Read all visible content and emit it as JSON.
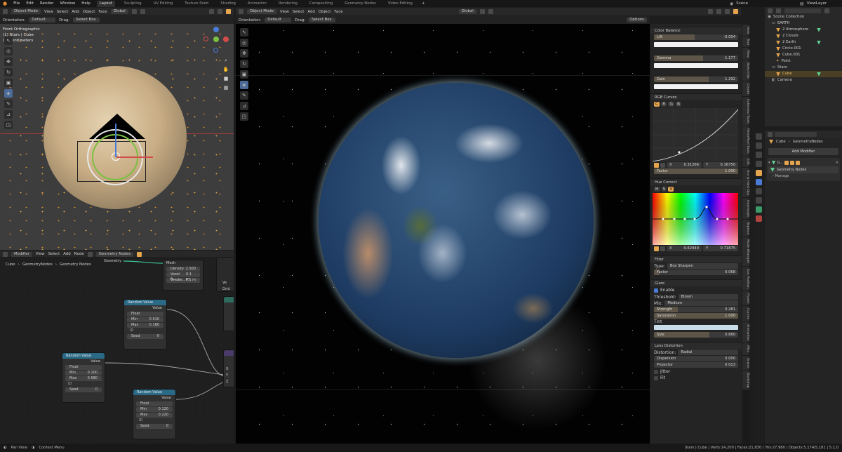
{
  "topbar": {
    "menus": [
      "File",
      "Edit",
      "Render",
      "Window",
      "Help"
    ],
    "workspaces": [
      "Layout",
      "Sculpting",
      "UV Editing",
      "Texture Paint",
      "Shading",
      "Animation",
      "Rendering",
      "Compositing",
      "Geometry Nodes",
      "Video Editing"
    ],
    "scene": "Scene",
    "view_layer": "ViewLayer"
  },
  "left_viewport": {
    "mode": "Object Mode",
    "menus": [
      "View",
      "Select",
      "Add",
      "Object",
      "Face"
    ],
    "transform": "Global",
    "orientation_label": "Orientation:",
    "orientation": "Default",
    "drag_label": "Drag:",
    "drag": "Select Box",
    "info": [
      "Front Orthographic",
      "(1) Stars | Cube",
      "10 Centimeters"
    ]
  },
  "main_viewport": {
    "mode": "Object Mode",
    "menus": [
      "View",
      "Select",
      "Add",
      "Object",
      "Face"
    ],
    "transform": "Global",
    "orientation_label": "Orientation:",
    "orientation": "Default",
    "drag_label": "Drag:",
    "drag": "Select Box",
    "options": "Options"
  },
  "node_editor": {
    "header": {
      "editor": "Modifier",
      "menus": [
        "View",
        "Select",
        "Add",
        "Node"
      ],
      "tree": "Geometry Nodes"
    },
    "breadcrumb": [
      "Cube",
      "GeometryNodes",
      "Geometry Nodes"
    ],
    "mesh_node": {
      "geometry": "Geometry",
      "title": "Mesh",
      "fields": [
        {
          "label": "Density",
          "value": "2.500"
        },
        {
          "label": "Voxel S...",
          "value": "0.1 m"
        },
        {
          "label": "Gradie...",
          "value": "0.1 m"
        }
      ],
      "grid": "Grid"
    },
    "rv1": {
      "title": "Random Value",
      "output": "Value",
      "type": "Float",
      "min": "0.010",
      "max": "0.180",
      "id": "ID",
      "seed": "0"
    },
    "rv2": {
      "title": "Random Value",
      "output": "Value",
      "type": "Float",
      "min": "0.100",
      "max": "0.580",
      "id": "ID",
      "seed": "0"
    },
    "rv3": {
      "title": "Random Value",
      "output": "Value",
      "type": "Float",
      "min": "0.120",
      "max": "0.220",
      "id": "ID",
      "seed": "0"
    },
    "combine": {
      "inputs": [
        "X",
        "Y",
        "Z"
      ]
    },
    "side": [
      "Ve",
      "X",
      "Y",
      "Z"
    ]
  },
  "compositor": {
    "color_balance": {
      "title": "Color Balance",
      "lift_label": "Lift",
      "lift": "-0.004",
      "gamma_label": "Gamma",
      "gamma": "1.177",
      "gain_label": "Gain",
      "gain": "1.292"
    },
    "rgb_curves": {
      "title": "RGB Curves",
      "channels": [
        "C",
        "R",
        "G",
        "B"
      ],
      "x_label": "X",
      "x": "0.31266",
      "y_label": "Y",
      "y": "0.16750",
      "factor_label": "Factor",
      "factor": "1.000"
    },
    "hue_correct": {
      "title": "Hue Correct",
      "channels": [
        "H",
        "S",
        "V"
      ],
      "x_label": "X",
      "x": "0.62940",
      "y_label": "Y",
      "y": "0.71875"
    },
    "filter": {
      "title": "Filter",
      "type_label": "Type:",
      "type": "Box Sharpen",
      "factor_label": "Factor",
      "factor": "0.068"
    },
    "glare": {
      "title": "Glare",
      "enable": "Enable",
      "threshold_label": "Threshold:",
      "threshold": "Bloom",
      "mix_label": "Mix:",
      "mix": "Medium",
      "strength_label": "Strength",
      "strength": "0.281",
      "saturation_label": "Saturation",
      "saturation": "1.000",
      "tint_label": "Tint",
      "size_label": "Size",
      "size": "0.660"
    },
    "lens": {
      "title": "Lens Distortion",
      "distortion_label": "Distortion:",
      "distortion": "Radial",
      "dispersion_label": "Dispersion",
      "dispersion": "0.000",
      "projector_label": "Projector",
      "projector": "0.013",
      "jitter": "Jitter",
      "fit": "Fit"
    }
  },
  "side_tabs": [
    "Item",
    "Tool",
    "View",
    "Sketchfab",
    "Create",
    "Extended Tools",
    "RetroPixel Tools",
    "Edit",
    "Uvs & Hard Ops",
    "Geomorph",
    "Replace",
    "Node Wrangler",
    "Sun Position",
    "Fluent",
    "Curves",
    "Animation",
    "Misc",
    "Scene",
    "Backdrop"
  ],
  "outliner": {
    "search": "",
    "items": [
      {
        "label": "Scene Collection",
        "indent": 0
      },
      {
        "label": "EARTH",
        "indent": 1
      },
      {
        "label": "2 Atmosphere",
        "indent": 2
      },
      {
        "label": "2 Clouds",
        "indent": 2
      },
      {
        "label": "2 Earth",
        "indent": 2
      },
      {
        "label": "Circle.001",
        "indent": 2
      },
      {
        "label": "Cube.001",
        "indent": 2
      },
      {
        "label": "Point",
        "indent": 2
      },
      {
        "label": "Stars",
        "indent": 1
      },
      {
        "label": "Cube",
        "indent": 2,
        "selected": true
      },
      {
        "label": "Camera",
        "indent": 1
      }
    ]
  },
  "properties": {
    "breadcrumb": [
      "Cube",
      "GeometryNodes"
    ],
    "add_modifier": "Add Modifier",
    "modifier_short": "G...",
    "modifier_tree": "Geometry Nodes",
    "manage": "Manage"
  },
  "status": {
    "left": [
      "Pan View",
      "Context Menu"
    ],
    "right": "Stars | Cube | Verts:14,200 | Faces:21,830 | Tris:27,980 | Objects:5,174/5,181 | 5.1.0"
  },
  "colors": {
    "accent": "#e5a54f",
    "node_header": "#2a6a86",
    "selection": "#4a3f24",
    "star": "#d98a2b"
  }
}
